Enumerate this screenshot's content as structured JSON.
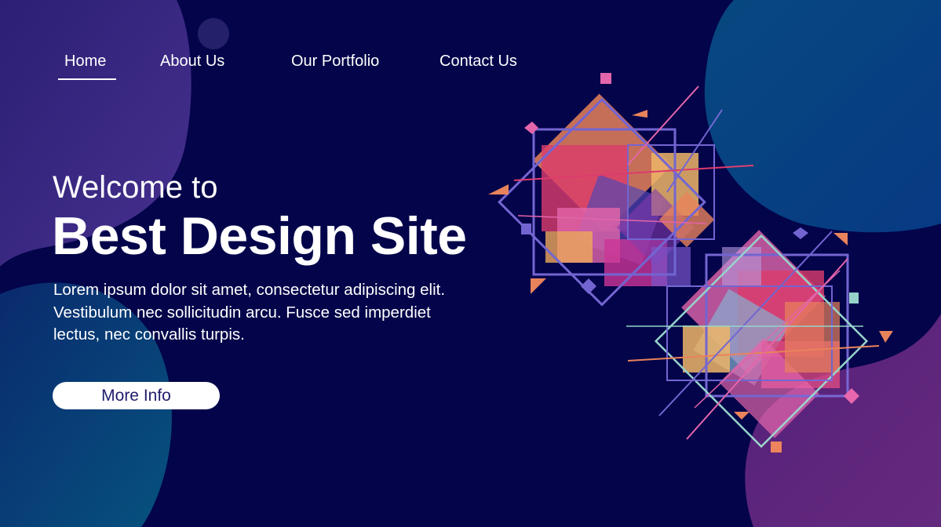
{
  "nav": {
    "items": [
      {
        "label": "Home",
        "active": true
      },
      {
        "label": "About Us",
        "active": false
      },
      {
        "label": "Our Portfolio",
        "active": false
      },
      {
        "label": "Contact Us",
        "active": false
      }
    ]
  },
  "hero": {
    "welcome": "Welcome to",
    "title": "Best Design Site",
    "body": "Lorem ipsum dolor sit amet, consectetur adipiscing elit. Vestibulum nec sollicitudin arcu. Fusce sed imperdiet lectus, nec convallis turpis.",
    "button_label": "More Info"
  },
  "colors": {
    "background": "#03044a",
    "button_text": "#1f1d6b",
    "blob_purple": "#3b2a86",
    "blob_teal": "#0a3f80",
    "blob_magenta": "#5e237a"
  },
  "icons": [
    "geometric-art-illustration"
  ]
}
